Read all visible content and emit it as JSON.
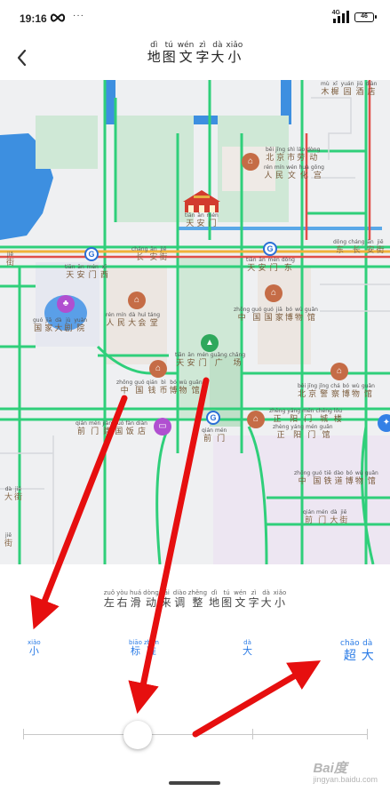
{
  "status_bar": {
    "time": "19:16",
    "network": "4G",
    "battery": "46"
  },
  "header": {
    "title": [
      {
        "py": "dì",
        "ch": "地"
      },
      {
        "py": "tú",
        "ch": "图"
      },
      {
        "py": "wén",
        "ch": "文"
      },
      {
        "py": "zì",
        "ch": "字"
      },
      {
        "py": "dà",
        "ch": "大"
      },
      {
        "py": "xiǎo",
        "ch": "小"
      }
    ]
  },
  "map": {
    "labels": {
      "tiananmen": [
        {
          "py": "tiān",
          "ch": "天"
        },
        {
          "py": "ān",
          "ch": "安"
        },
        {
          "py": "mén",
          "ch": "门"
        }
      ],
      "changan": [
        {
          "py": "cháng",
          "ch": "长"
        },
        {
          "py": "ān",
          "ch": "安"
        },
        {
          "py": "jiē",
          "ch": "街"
        }
      ],
      "changan_east": [
        {
          "py": "dōng",
          "ch": "东"
        },
        {
          "py": "cháng",
          "ch": "长"
        },
        {
          "py": "ān",
          "ch": "安"
        },
        {
          "py": "jiē",
          "ch": "街"
        }
      ],
      "tam_west": [
        {
          "py": "tiān",
          "ch": "天"
        },
        {
          "py": "ān",
          "ch": "安"
        },
        {
          "py": "mén",
          "ch": "门"
        },
        {
          "py": "xī",
          "ch": "西"
        }
      ],
      "tam_east": [
        {
          "py": "tiān",
          "ch": "天"
        },
        {
          "py": "ān",
          "ch": "安"
        },
        {
          "py": "mén",
          "ch": "门"
        },
        {
          "py": "dōng",
          "ch": "东"
        }
      ],
      "beijing_labor": [
        {
          "py": "běi",
          "ch": "北"
        },
        {
          "py": "jīng",
          "ch": "京"
        },
        {
          "py": "shì",
          "ch": "市"
        },
        {
          "py": "láo",
          "ch": "劳"
        },
        {
          "py": "dòng",
          "ch": "动"
        }
      ],
      "people_palace": [
        {
          "py": "rén",
          "ch": "人"
        },
        {
          "py": "mín",
          "ch": "民"
        },
        {
          "py": "wén",
          "ch": "文"
        },
        {
          "py": "huà",
          "ch": "化"
        },
        {
          "py": "gōng",
          "ch": "宫"
        }
      ],
      "grand_theatre": [
        {
          "py": "guó",
          "ch": "国"
        },
        {
          "py": "jiā",
          "ch": "家"
        },
        {
          "py": "dà",
          "ch": "大"
        },
        {
          "py": "jù",
          "ch": "剧"
        },
        {
          "py": "yuàn",
          "ch": "院"
        }
      ],
      "great_hall": [
        {
          "py": "rén",
          "ch": "人"
        },
        {
          "py": "mín",
          "ch": "民"
        },
        {
          "py": "dà",
          "ch": "大"
        },
        {
          "py": "huì",
          "ch": "会"
        },
        {
          "py": "táng",
          "ch": "堂"
        }
      ],
      "national_museum": [
        {
          "py": "zhōng",
          "ch": "中"
        },
        {
          "py": "guó",
          "ch": "国"
        },
        {
          "py": "guó",
          "ch": "国"
        },
        {
          "py": "jiā",
          "ch": "家"
        },
        {
          "py": "bó",
          "ch": "博"
        },
        {
          "py": "wù",
          "ch": "物"
        },
        {
          "py": "guǎn",
          "ch": "馆"
        }
      ],
      "square": [
        {
          "py": "tiān",
          "ch": "天"
        },
        {
          "py": "ān",
          "ch": "安"
        },
        {
          "py": "mén",
          "ch": "门"
        },
        {
          "py": "guǎng",
          "ch": "广"
        },
        {
          "py": "chǎng",
          "ch": "场"
        }
      ],
      "coin_museum": [
        {
          "py": "zhōng",
          "ch": "中"
        },
        {
          "py": "guó",
          "ch": "国"
        },
        {
          "py": "qián",
          "ch": "钱"
        },
        {
          "py": "bì",
          "ch": "币"
        },
        {
          "py": "bó",
          "ch": "博"
        },
        {
          "py": "wù",
          "ch": "物"
        },
        {
          "py": "guǎn",
          "ch": "馆"
        }
      ],
      "police_museum": [
        {
          "py": "běi",
          "ch": "北"
        },
        {
          "py": "jīng",
          "ch": "京"
        },
        {
          "py": "jǐng",
          "ch": "警"
        },
        {
          "py": "chá",
          "ch": "察"
        },
        {
          "py": "bó",
          "ch": "博"
        },
        {
          "py": "wù",
          "ch": "物"
        },
        {
          "py": "guǎn",
          "ch": "馆"
        }
      ],
      "qianmen_station": [
        {
          "py": "qián",
          "ch": "前"
        },
        {
          "py": "mén",
          "ch": "门"
        }
      ],
      "qianmen_hotel": [
        {
          "py": "qián",
          "ch": "前"
        },
        {
          "py": "mén",
          "ch": "门"
        },
        {
          "py": "jiàn",
          "ch": "建"
        },
        {
          "py": "guó",
          "ch": "国"
        },
        {
          "py": "fàn",
          "ch": "饭"
        },
        {
          "py": "diàn",
          "ch": "店"
        }
      ],
      "zhengyangmen": [
        {
          "py": "zhèng",
          "ch": "正"
        },
        {
          "py": "yáng",
          "ch": "阳"
        },
        {
          "py": "mén",
          "ch": "门"
        },
        {
          "py": "chéng",
          "ch": "城"
        },
        {
          "py": "lóu",
          "ch": "楼"
        }
      ],
      "qianmen_street": [
        {
          "py": "qián",
          "ch": "前"
        },
        {
          "py": "mén",
          "ch": "门"
        },
        {
          "py": "dà",
          "ch": "大"
        },
        {
          "py": "jiē",
          "ch": "街"
        }
      ],
      "railway_museum": [
        {
          "py": "zhōng",
          "ch": "中"
        },
        {
          "py": "guó",
          "ch": "国"
        },
        {
          "py": "tiě",
          "ch": "铁"
        },
        {
          "py": "dào",
          "ch": "道"
        },
        {
          "py": "bó",
          "ch": "博"
        },
        {
          "py": "wù",
          "ch": "物"
        },
        {
          "py": "guǎn",
          "ch": "馆"
        }
      ],
      "zhengyangmen2": [
        {
          "py": "zhèng",
          "ch": "正"
        },
        {
          "py": "yáng",
          "ch": "阳"
        },
        {
          "py": "mén",
          "ch": "门"
        },
        {
          "py": "guǎn",
          "ch": "馆"
        }
      ],
      "muxi": [
        {
          "py": "mù",
          "ch": "木"
        },
        {
          "py": "xī",
          "ch": "樨"
        },
        {
          "py": "yuán",
          "ch": "园"
        },
        {
          "py": "jiǔ",
          "ch": "酒"
        },
        {
          "py": "diàn",
          "ch": "店"
        }
      ],
      "dajie": [
        {
          "py": "dà",
          "ch": "大"
        },
        {
          "py": "jiē",
          "ch": "街"
        }
      ],
      "jie": [
        {
          "py": "jiē",
          "ch": "街"
        }
      ]
    }
  },
  "panel": {
    "hint": [
      {
        "py": "zuǒ",
        "ch": "左"
      },
      {
        "py": "yòu",
        "ch": "右"
      },
      {
        "py": "huá",
        "ch": "滑"
      },
      {
        "py": "dòng",
        "ch": "动"
      },
      {
        "py": "lái",
        "ch": "来"
      },
      {
        "py": "diào",
        "ch": "调"
      },
      {
        "py": "zhěng",
        "ch": "整"
      },
      {
        "py": "dì",
        "ch": "地"
      },
      {
        "py": "tú",
        "ch": "图"
      },
      {
        "py": "wén",
        "ch": "文"
      },
      {
        "py": "zì",
        "ch": "字"
      },
      {
        "py": "dà",
        "ch": "大"
      },
      {
        "py": "xiǎo",
        "ch": "小"
      }
    ],
    "options": {
      "small": [
        {
          "py": "xiǎo",
          "ch": "小"
        }
      ],
      "standard": [
        {
          "py": "biāo",
          "ch": "标"
        },
        {
          "py": "zhǔn",
          "ch": "准"
        }
      ],
      "large": [
        {
          "py": "dà",
          "ch": "大"
        }
      ],
      "extra_large": [
        {
          "py": "chāo",
          "ch": "超"
        },
        {
          "py": "dà",
          "ch": "大"
        }
      ]
    },
    "slider": {
      "level": 2,
      "levels": 5
    },
    "watermark": "Bai度",
    "watermark_sub": "jingyan.baidu.com"
  },
  "colors": {
    "accent": "#2a7be6",
    "road": "#2fcf7a",
    "arrow": "#e60f0f",
    "water": "#3d8fe0"
  }
}
